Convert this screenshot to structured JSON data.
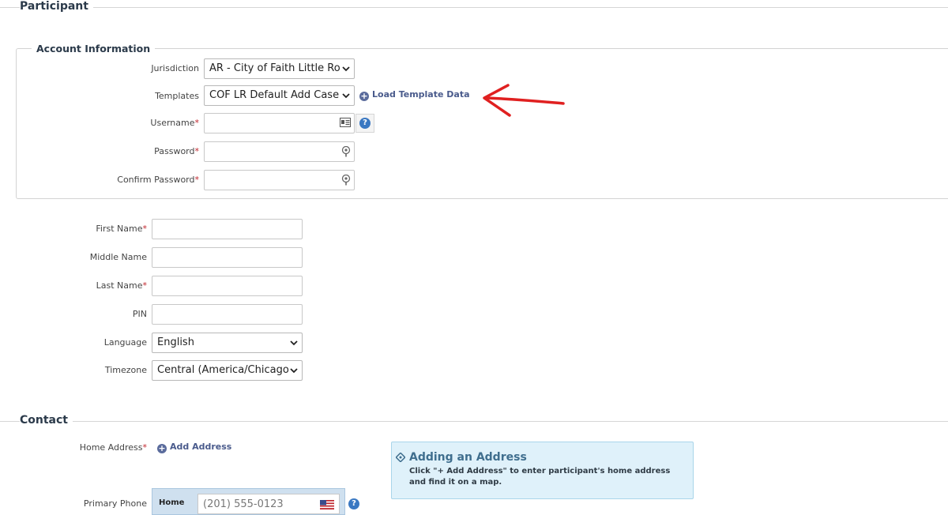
{
  "participant": {
    "title": "Participant"
  },
  "account": {
    "legend": "Account Information",
    "jurisdiction": {
      "label": "Jurisdiction",
      "value": "AR - City of Faith Little Ro"
    },
    "templates": {
      "label": "Templates",
      "value": "COF LR Default Add Case",
      "load_link": "Load Template Data"
    },
    "username": {
      "label": "Username",
      "required": "*"
    },
    "password": {
      "label": "Password",
      "required": "*"
    },
    "confirm_password": {
      "label": "Confirm Password",
      "required": "*"
    }
  },
  "person": {
    "first_name": {
      "label": "First Name",
      "required": "*"
    },
    "middle_name": {
      "label": "Middle Name"
    },
    "last_name": {
      "label": "Last Name",
      "required": "*"
    },
    "pin": {
      "label": "PIN"
    },
    "language": {
      "label": "Language",
      "value": "English"
    },
    "timezone": {
      "label": "Timezone",
      "value": "Central (America/Chicago"
    }
  },
  "contact": {
    "title": "Contact",
    "home_address": {
      "label": "Home Address",
      "required": "*",
      "add_link": "Add Address"
    },
    "info": {
      "title": "Adding an Address",
      "text": "Click \"+ Add Address\" to enter participant's home address and find it on a map."
    },
    "primary_phone": {
      "label": "Primary Phone",
      "type": "Home",
      "placeholder": "(201) 555-0123"
    }
  },
  "colors": {
    "annotation_arrow": "#e02020",
    "required": "#c0262d",
    "link": "#4a5b8c"
  }
}
